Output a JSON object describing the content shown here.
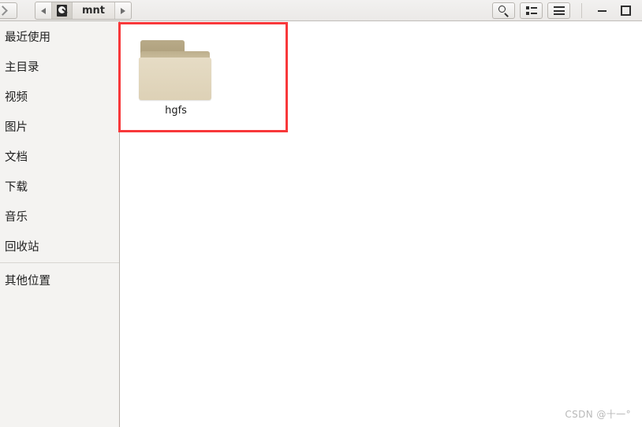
{
  "window": {
    "title": "mnt"
  },
  "toolbar": {
    "nav_forward_icon": "chevron-right-icon",
    "path_back_icon": "triangle-left-icon",
    "path_forward_icon": "triangle-right-icon",
    "breadcrumb_drive_icon": "drive-icon",
    "breadcrumb_label": "mnt",
    "search_icon": "search-icon",
    "view_toggle_icon": "list-view-icon",
    "menu_icon": "hamburger-menu-icon",
    "minimize_icon": "minimize-icon",
    "maximize_icon": "maximize-icon"
  },
  "sidebar": {
    "items": [
      {
        "label": "最近使用",
        "name": "sidebar-item-recent"
      },
      {
        "label": "主目录",
        "name": "sidebar-item-home"
      },
      {
        "label": "视频",
        "name": "sidebar-item-videos"
      },
      {
        "label": "图片",
        "name": "sidebar-item-pictures"
      },
      {
        "label": "文档",
        "name": "sidebar-item-documents"
      },
      {
        "label": "下载",
        "name": "sidebar-item-downloads"
      },
      {
        "label": "音乐",
        "name": "sidebar-item-music"
      },
      {
        "label": "回收站",
        "name": "sidebar-item-trash"
      }
    ],
    "other_locations": "其他位置"
  },
  "main": {
    "files": [
      {
        "name": "hgfs",
        "icon": "folder-icon"
      }
    ]
  },
  "annotation": {
    "rect_color": "#f8383a"
  },
  "watermark": {
    "text": "CSDN @十一°"
  }
}
